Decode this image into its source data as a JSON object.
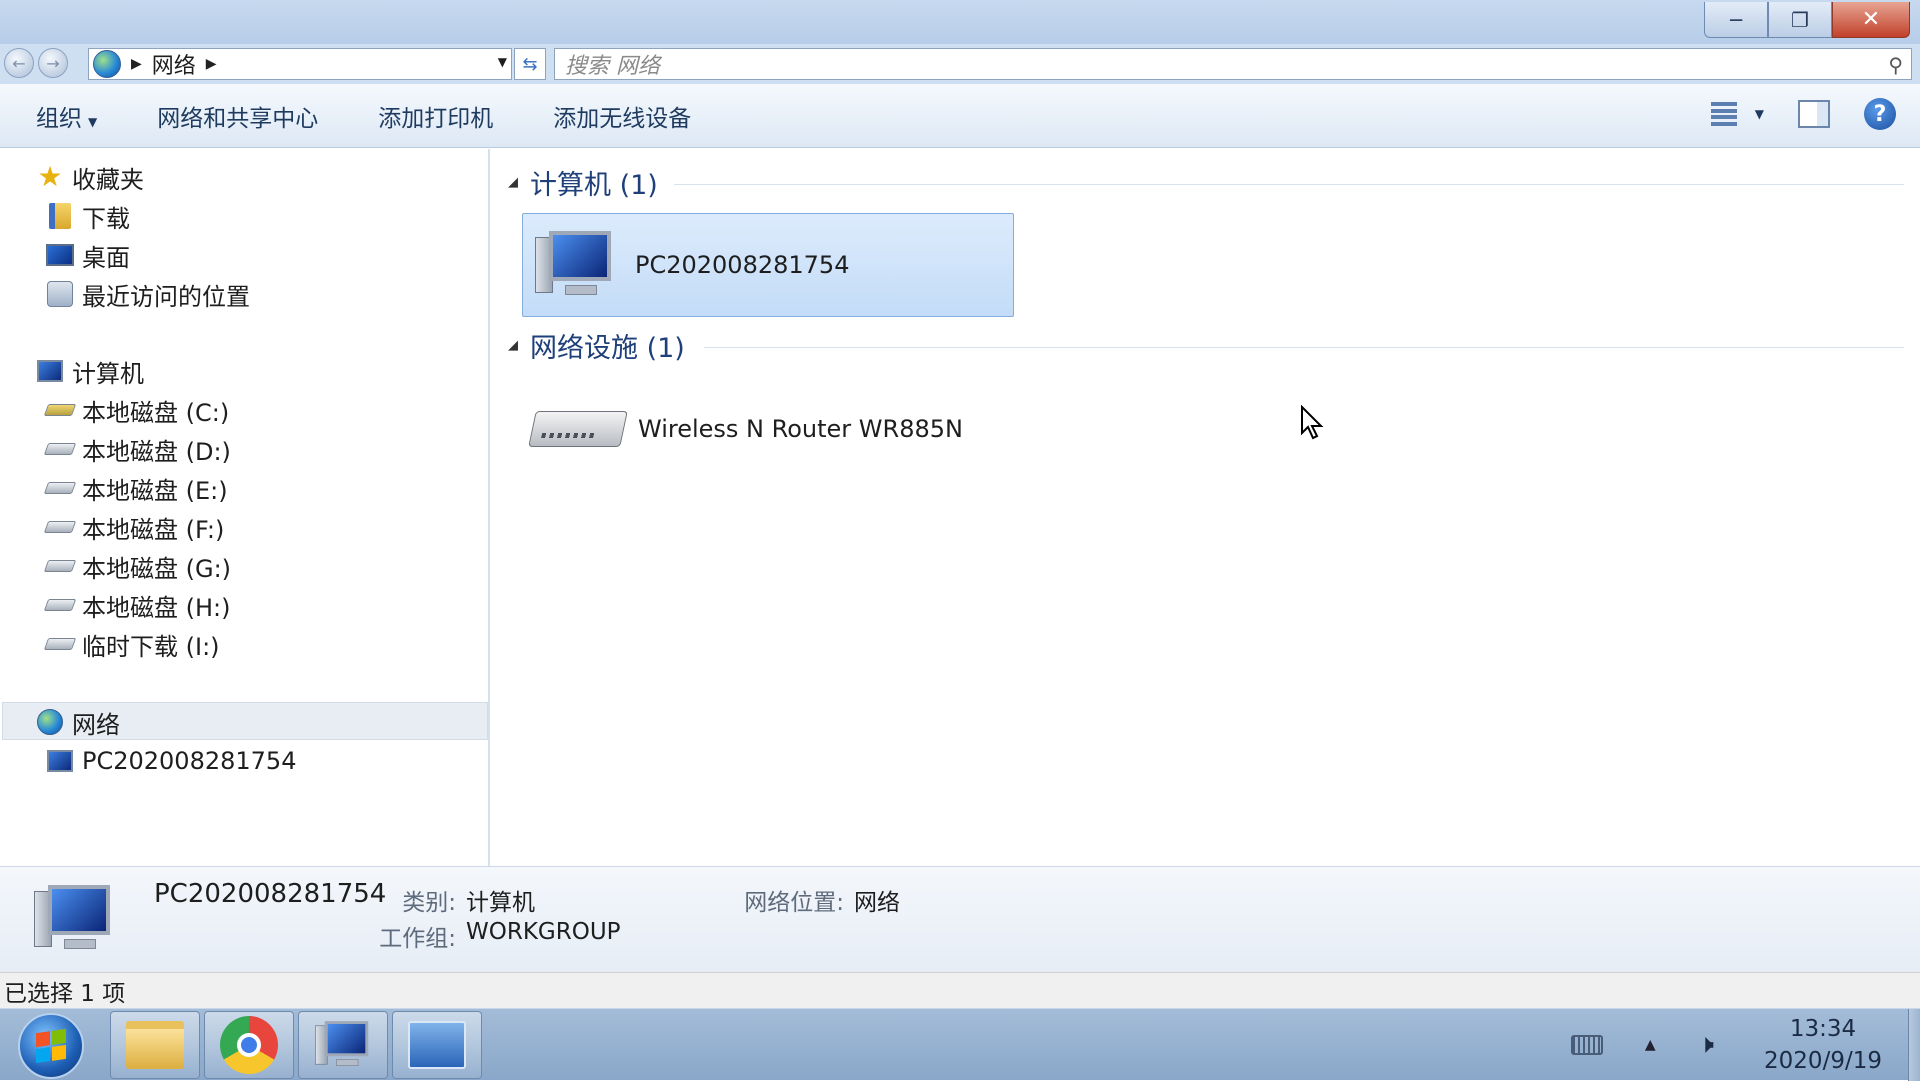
{
  "window": {
    "controls": {
      "minimize": "─",
      "restore": "❐",
      "close": "✕"
    }
  },
  "address": {
    "crumb": "网络",
    "search_placeholder": "搜索 网络"
  },
  "toolbar": {
    "organize": "组织",
    "network_center": "网络和共享中心",
    "add_printer": "添加打印机",
    "add_wireless": "添加无线设备",
    "help": "?"
  },
  "sidebar": {
    "favorites": "收藏夹",
    "downloads": "下载",
    "desktop": "桌面",
    "recent": "最近访问的位置",
    "computer": "计算机",
    "drives": [
      "本地磁盘 (C:)",
      "本地磁盘 (D:)",
      "本地磁盘 (E:)",
      "本地磁盘 (F:)",
      "本地磁盘 (G:)",
      "本地磁盘 (H:)",
      "临时下载 (I:)"
    ],
    "network": "网络",
    "network_pc": "PC202008281754"
  },
  "content": {
    "group_computers": "计算机 (1)",
    "group_infrastructure": "网络设施 (1)",
    "computer_item": "PC202008281754",
    "router_item": "Wireless N Router WR885N"
  },
  "details": {
    "name": "PC202008281754",
    "category_label": "类别:",
    "category_value": "计算机",
    "workgroup_label": "工作组:",
    "workgroup_value": "WORKGROUP",
    "location_label": "网络位置:",
    "location_value": "网络"
  },
  "status": {
    "selected": "已选择 1 项"
  },
  "taskbar": {
    "time": "13:34",
    "date": "2020/9/19"
  }
}
